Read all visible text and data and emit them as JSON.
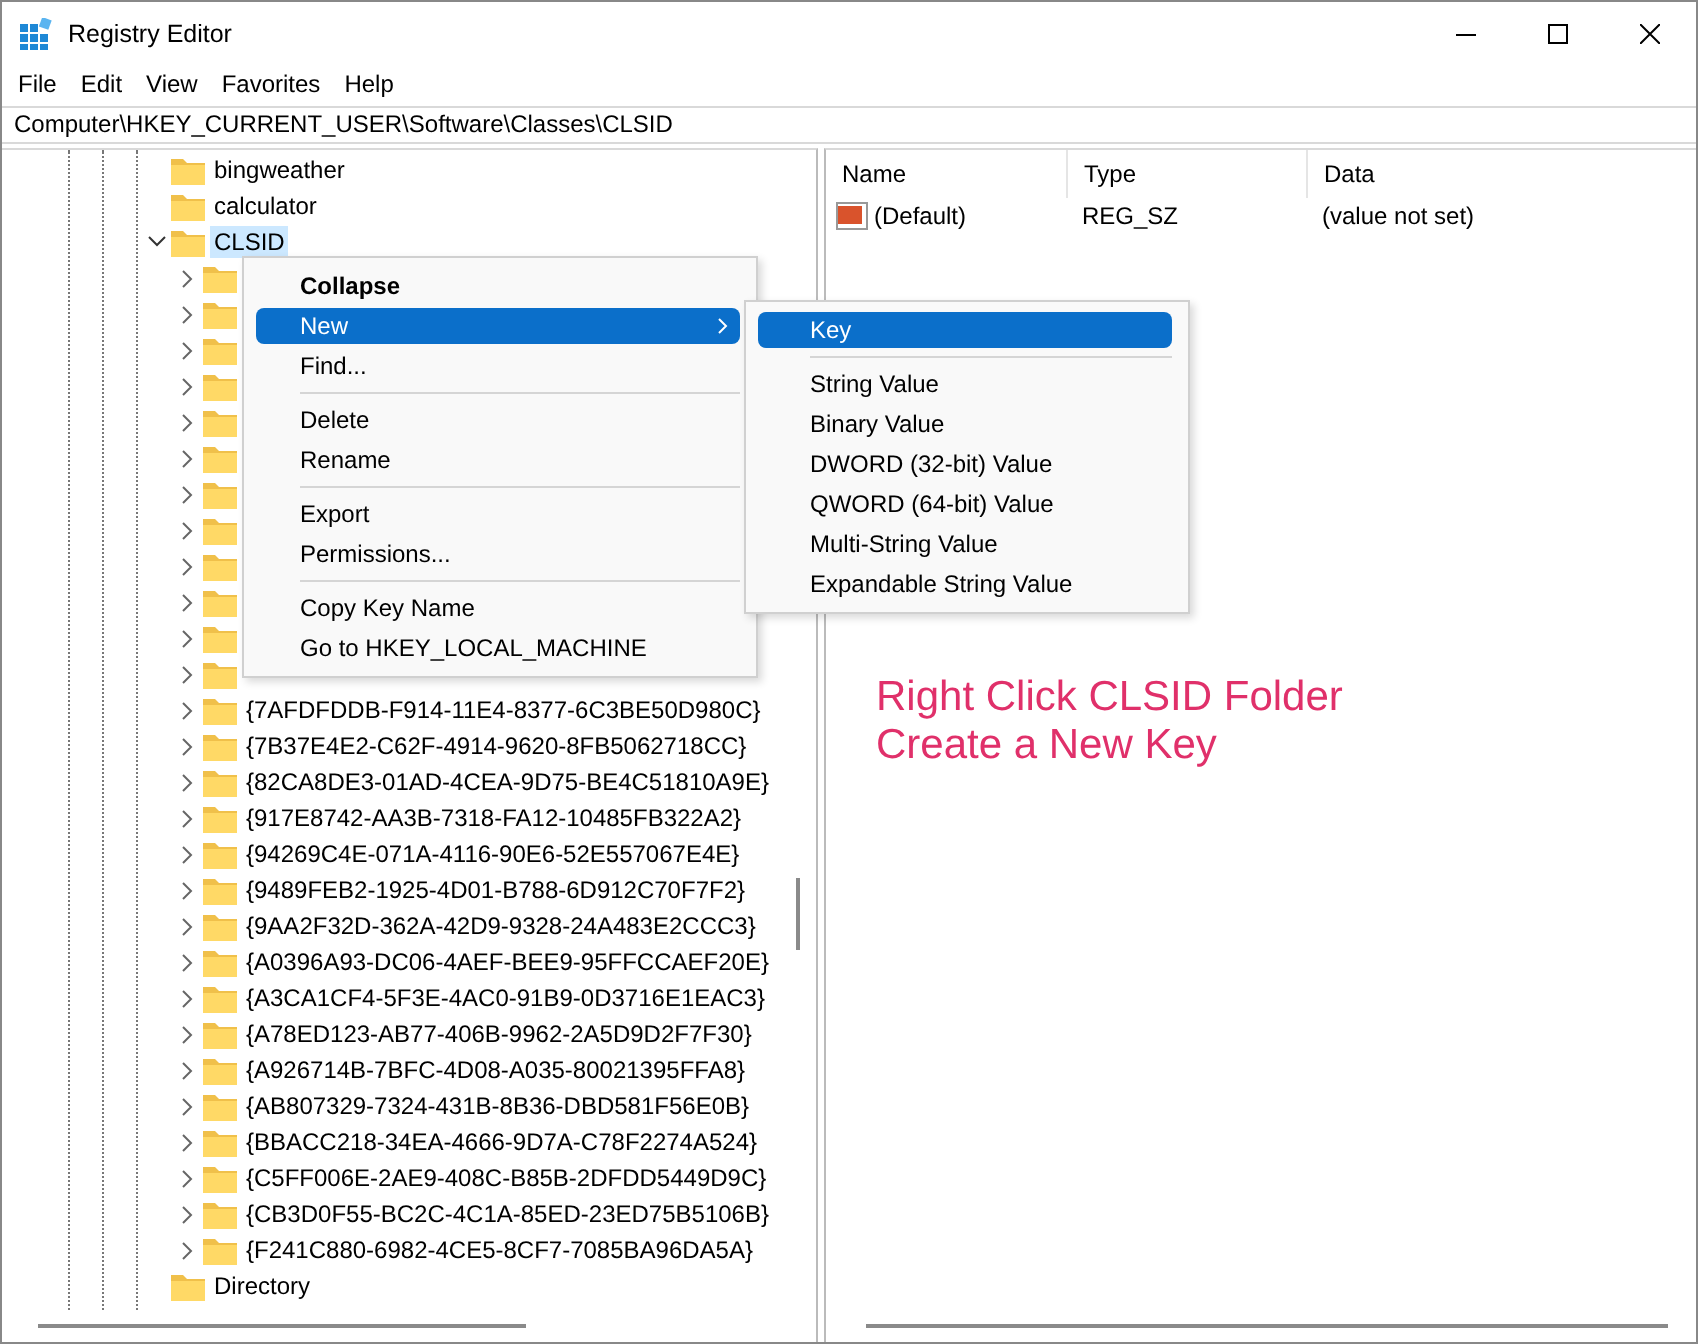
{
  "window": {
    "title": "Registry Editor"
  },
  "menu_bar": [
    "File",
    "Edit",
    "View",
    "Favorites",
    "Help"
  ],
  "address": "Computer\\HKEY_CURRENT_USER\\Software\\Classes\\CLSID",
  "tree": [
    {
      "label": "bingweather",
      "selected": false
    },
    {
      "label": "calculator",
      "selected": false
    },
    {
      "label": "CLSID",
      "expanded": true,
      "selected": true,
      "children": [
        {
          "expanded": false,
          "selected": false
        },
        {
          "expanded": false,
          "selected": false
        },
        {
          "expanded": false,
          "selected": false
        },
        {
          "expanded": false,
          "selected": false
        },
        {
          "expanded": false,
          "selected": false
        },
        {
          "expanded": false,
          "selected": false
        },
        {
          "expanded": false,
          "selected": false
        },
        {
          "expanded": false,
          "selected": false
        },
        {
          "expanded": false,
          "selected": false
        },
        {
          "expanded": false,
          "selected": false
        },
        {
          "expanded": false,
          "selected": false
        },
        {
          "expanded": false,
          "selected": false
        },
        {
          "label": "{7AFDFDDB-F914-11E4-8377-6C3BE50D980C}",
          "expanded": false,
          "selected": false
        },
        {
          "label": "{7B37E4E2-C62F-4914-9620-8FB5062718CC}",
          "expanded": false,
          "selected": false
        },
        {
          "label": "{82CA8DE3-01AD-4CEA-9D75-BE4C51810A9E}",
          "expanded": false,
          "selected": false
        },
        {
          "label": "{917E8742-AA3B-7318-FA12-10485FB322A2}",
          "expanded": false,
          "selected": false
        },
        {
          "label": "{94269C4E-071A-4116-90E6-52E557067E4E}",
          "expanded": false,
          "selected": false
        },
        {
          "label": "{9489FEB2-1925-4D01-B788-6D912C70F7F2}",
          "expanded": false,
          "selected": false
        },
        {
          "label": "{9AA2F32D-362A-42D9-9328-24A483E2CCC3}",
          "expanded": false,
          "selected": false
        },
        {
          "label": "{A0396A93-DC06-4AEF-BEE9-95FFCCAEF20E}",
          "expanded": false,
          "selected": false
        },
        {
          "label": "{A3CA1CF4-5F3E-4AC0-91B9-0D3716E1EAC3}",
          "expanded": false,
          "selected": false
        },
        {
          "label": "{A78ED123-AB77-406B-9962-2A5D9D2F7F30}",
          "expanded": false,
          "selected": false
        },
        {
          "label": "{A926714B-7BFC-4D08-A035-80021395FFA8}",
          "expanded": false,
          "selected": false
        },
        {
          "label": "{AB807329-7324-431B-8B36-DBD581F56E0B}",
          "expanded": false,
          "selected": false
        },
        {
          "label": "{BBACC218-34EA-4666-9D7A-C78F2274A524}",
          "expanded": false,
          "selected": false
        },
        {
          "label": "{C5FF006E-2AE9-408C-B85B-2DFDD5449D9C}",
          "expanded": false,
          "selected": false
        },
        {
          "label": "{CB3D0F55-BC2C-4C1A-85ED-23ED75B5106B}",
          "expanded": false,
          "selected": false
        },
        {
          "label": "{F241C880-6982-4CE5-8CF7-7085BA96DA5A}",
          "expanded": false,
          "selected": false
        }
      ]
    },
    {
      "label": "Directory",
      "selected": false
    }
  ],
  "values": {
    "columns": [
      "Name",
      "Type",
      "Data"
    ],
    "rows": [
      {
        "name": "(Default)",
        "type": "REG_SZ",
        "data": "(value not set)",
        "selected": false
      }
    ]
  },
  "context_menu": [
    {
      "kind": "item",
      "label": "Collapse",
      "default": true,
      "selected": false
    },
    {
      "kind": "item",
      "label": "New",
      "submenu": true,
      "selected": true
    },
    {
      "kind": "item",
      "label": "Find...",
      "selected": false
    },
    {
      "kind": "separator"
    },
    {
      "kind": "item",
      "label": "Delete",
      "selected": false
    },
    {
      "kind": "item",
      "label": "Rename",
      "selected": false
    },
    {
      "kind": "separator"
    },
    {
      "kind": "item",
      "label": "Export",
      "selected": false
    },
    {
      "kind": "item",
      "label": "Permissions...",
      "selected": false
    },
    {
      "kind": "separator"
    },
    {
      "kind": "item",
      "label": "Copy Key Name",
      "selected": false
    },
    {
      "kind": "item",
      "label": "Go to HKEY_LOCAL_MACHINE",
      "selected": false
    }
  ],
  "submenu": [
    {
      "kind": "item",
      "label": "Key",
      "selected": true
    },
    {
      "kind": "separator"
    },
    {
      "kind": "item",
      "label": "String Value",
      "selected": false
    },
    {
      "kind": "item",
      "label": "Binary Value",
      "selected": false
    },
    {
      "kind": "item",
      "label": "DWORD (32-bit) Value",
      "selected": false
    },
    {
      "kind": "item",
      "label": "QWORD (64-bit) Value",
      "selected": false
    },
    {
      "kind": "item",
      "label": "Multi-String Value",
      "selected": false
    },
    {
      "kind": "item",
      "label": "Expandable String Value",
      "selected": false
    }
  ],
  "annotation": [
    "Right Click CLSID Folder",
    "Create a New Key"
  ]
}
